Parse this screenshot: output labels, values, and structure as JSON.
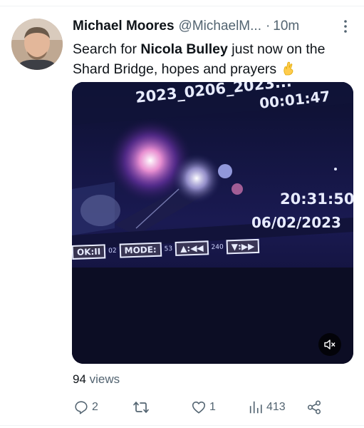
{
  "tweet": {
    "author_name": "Michael Moores",
    "author_handle": "@MichaelM...",
    "separator": "·",
    "time_ago": "10m",
    "text_part1": "Search for ",
    "text_bold": "Nicola Bulley",
    "text_part2": " just now on the Shard Bridge, hopes and prayers",
    "emoji": "crossed-fingers-icon"
  },
  "media": {
    "osd_filename": "2023_0206_2023...",
    "osd_recording_time": "00:01:47",
    "osd_clock": "20:31:50",
    "osd_date": "06/02/2023",
    "osd_buttons": {
      "ok": "OK:II",
      "mode": "MODE:",
      "rewind": "▲:◀◀",
      "forward": "▼:▶▶"
    },
    "osd_small": {
      "a": "02",
      "b": "53",
      "c": "240"
    },
    "muted": true
  },
  "stats": {
    "views_count": "94",
    "views_label": " views"
  },
  "actions": {
    "replies": "2",
    "retweets": "",
    "likes": "1",
    "views": "413"
  },
  "colors": {
    "text_primary": "#0f1419",
    "text_secondary": "#536471",
    "divider": "#eff3f4"
  }
}
